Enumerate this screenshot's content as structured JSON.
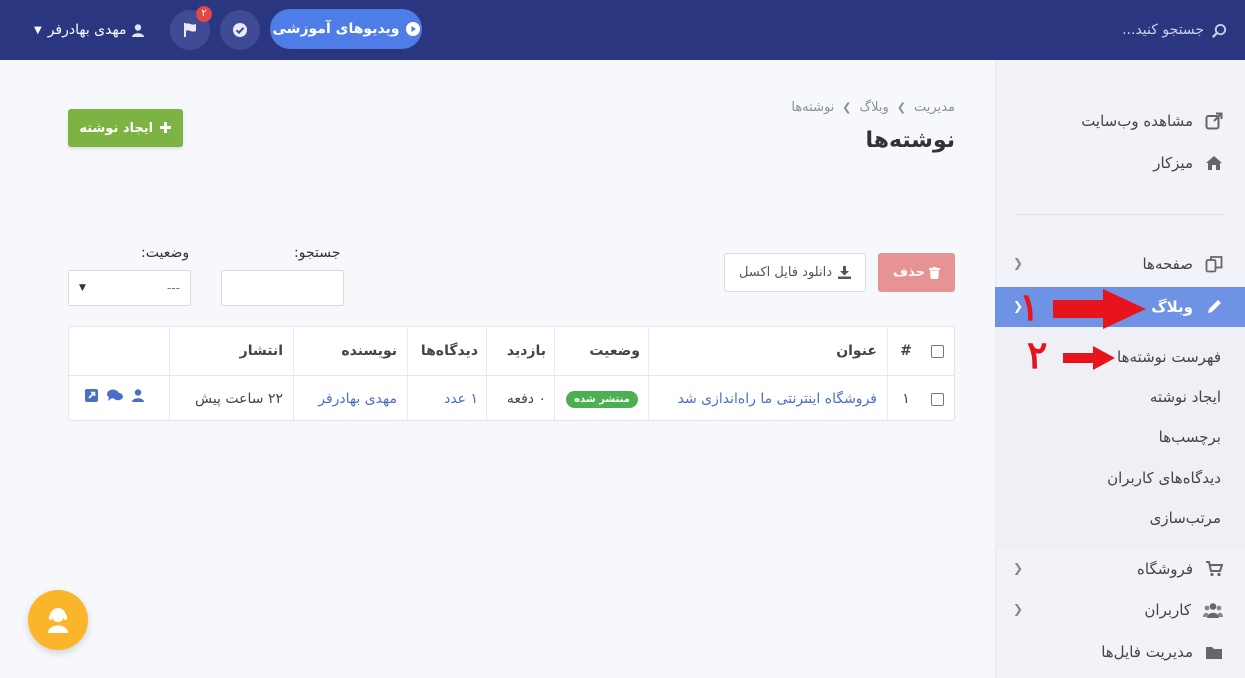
{
  "topbar": {
    "search_placeholder": "جستجو کنید...",
    "user_name": "مهدی بهادرفر",
    "notifications_count": "۲",
    "video_button": "ویدیوهای آموزشی"
  },
  "sidebar": {
    "items": [
      {
        "label": "مشاهده وب‌سایت",
        "icon": "external-link-icon"
      },
      {
        "label": "میزکار",
        "icon": "home-icon"
      },
      {
        "label": "صفحه‌ها",
        "icon": "pages-icon"
      },
      {
        "label": "وبلاگ",
        "icon": "pencil-icon"
      },
      {
        "label": "فروشگاه",
        "icon": "cart-icon"
      },
      {
        "label": "کاربران",
        "icon": "users-icon"
      },
      {
        "label": "مدیریت فایل‌ها",
        "icon": "folder-icon"
      }
    ],
    "blog_submenu": [
      "فهرست نوشته‌ها",
      "ایجاد نوشته",
      "برچسب‌ها",
      "دیدگاه‌های کاربران",
      "مرتب‌سازی"
    ]
  },
  "annotations": {
    "one": "۱",
    "two": "۲"
  },
  "page": {
    "breadcrumb": [
      "مدیریت",
      "وبلاگ",
      "نوشته‌ها"
    ],
    "title": "نوشته‌ها",
    "create_button": "ایجاد نوشته",
    "delete_button": "حذف",
    "excel_button": "دانلود فایل اکسل",
    "search_label": "جستجو:",
    "status_label": "وضعیت:",
    "status_value": "---"
  },
  "table": {
    "headers": {
      "num": "#",
      "title": "عنوان",
      "status": "وضعیت",
      "views": "بازدید",
      "comments": "دیدگاه‌ها",
      "author": "نویسنده",
      "published": "انتشار"
    },
    "rows": [
      {
        "num": "۱",
        "title": "فروشگاه اینترنتی ما راه‌اندازی شد",
        "status": "منتشر شده",
        "views": "۰ دفعه",
        "comments": "۱ عدد",
        "author": "مهدی بهادرفر",
        "published": "۲۲ ساعت پیش"
      }
    ]
  },
  "colors": {
    "topbar": "#2a3680",
    "accent": "#4f7de8",
    "active_menu": "#6e93e4",
    "success": "#7cb342",
    "danger": "#e79393",
    "annotation": "#e8141b"
  }
}
